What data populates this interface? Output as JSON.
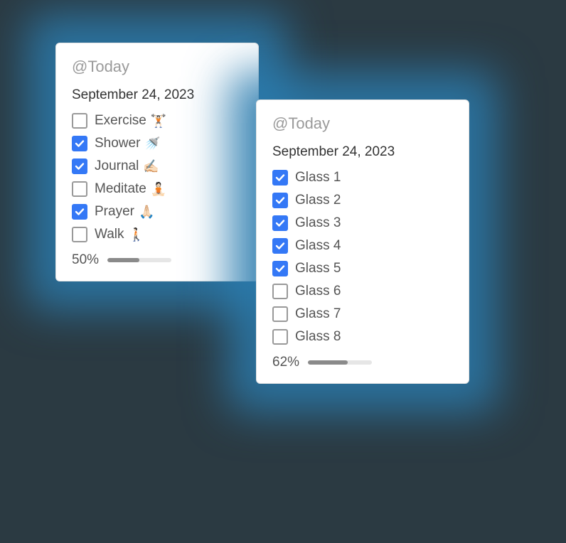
{
  "card1": {
    "title": "@Today",
    "date": "September 24, 2023",
    "tasks": [
      {
        "label": "Exercise",
        "emoji": "🏋🏻",
        "checked": false
      },
      {
        "label": "Shower",
        "emoji": "🚿",
        "checked": true
      },
      {
        "label": "Journal",
        "emoji": "✍🏻",
        "checked": true
      },
      {
        "label": "Meditate",
        "emoji": "🧘🏻",
        "checked": false
      },
      {
        "label": "Prayer",
        "emoji": "🙏🏻",
        "checked": true
      },
      {
        "label": "Walk",
        "emoji": "🚶🏻",
        "checked": false
      }
    ],
    "progress_pct": "50%",
    "progress_value": 50
  },
  "card2": {
    "title": "@Today",
    "date": "September 24, 2023",
    "tasks": [
      {
        "label": "Glass 1",
        "checked": true
      },
      {
        "label": "Glass 2",
        "checked": true
      },
      {
        "label": "Glass 3",
        "checked": true
      },
      {
        "label": "Glass 4",
        "checked": true
      },
      {
        "label": "Glass 5",
        "checked": true
      },
      {
        "label": "Glass 6",
        "checked": false
      },
      {
        "label": "Glass 7",
        "checked": false
      },
      {
        "label": "Glass 8",
        "checked": false
      }
    ],
    "progress_pct": "62%",
    "progress_value": 62
  }
}
